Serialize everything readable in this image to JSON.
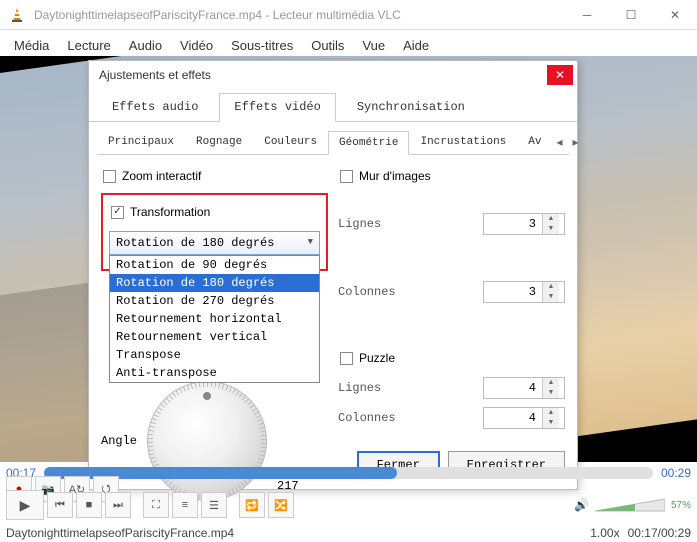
{
  "window": {
    "title": "DaytonighttimelapseofPariscityFrance.mp4 - Lecteur multimédia VLC"
  },
  "menu": {
    "media": "Média",
    "lecture": "Lecture",
    "audio": "Audio",
    "video": "Vidéo",
    "soustitres": "Sous-titres",
    "outils": "Outils",
    "vue": "Vue",
    "aide": "Aide"
  },
  "dialog": {
    "title": "Ajustements et effets",
    "tabs": {
      "audio": "Effets audio",
      "video": "Effets vidéo",
      "sync": "Synchronisation"
    },
    "subtabs": {
      "principaux": "Principaux",
      "rognage": "Rognage",
      "couleurs": "Couleurs",
      "geometrie": "Géométrie",
      "incrustations": "Incrustations",
      "av": "Av"
    },
    "geom": {
      "zoom": "Zoom interactif",
      "transformation": "Transformation",
      "combo_selected": "Rotation de 180 degrés",
      "options": {
        "r90": "Rotation de 90 degrés",
        "r180": "Rotation de 180 degrés",
        "r270": "Rotation de 270 degrés",
        "fliph": "Retournement horizontal",
        "flipv": "Retournement vertical",
        "transpose": "Transpose",
        "antitranspose": "Anti-transpose"
      },
      "angle_label": "Angle",
      "angle_value": "217",
      "mur": "Mur d'images",
      "lignes": "Lignes",
      "colonnes": "Colonnes",
      "mur_lignes": "3",
      "mur_colonnes": "3",
      "puzzle": "Puzzle",
      "puzzle_lignes": "4",
      "puzzle_colonnes": "4"
    },
    "footer": {
      "fermer": "Fermer",
      "enregistrer": "Enregistrer"
    }
  },
  "player": {
    "time_current": "00:17",
    "time_total": "00:29",
    "speed": "1.00x",
    "position": "00:17/00:29",
    "volume": "57%",
    "filename": "DaytonighttimelapseofPariscityFrance.mp4"
  }
}
